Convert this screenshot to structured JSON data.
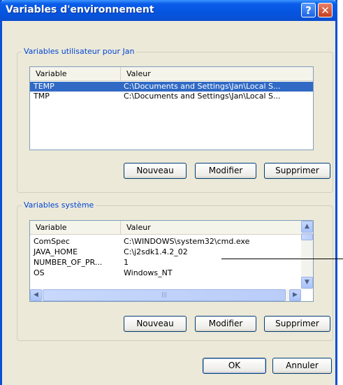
{
  "window": {
    "title": "Variables d'environnement",
    "help_glyph": "?",
    "close_glyph": "✕"
  },
  "user_vars": {
    "legend": "Variables utilisateur pour Jan",
    "columns": [
      "Variable",
      "Valeur"
    ],
    "rows": [
      {
        "name": "TEMP",
        "value": "C:\\Documents and Settings\\Jan\\Local S...",
        "selected": true
      },
      {
        "name": "TMP",
        "value": "C:\\Documents and Settings\\Jan\\Local S...",
        "selected": false
      }
    ],
    "buttons": {
      "new": "Nouveau",
      "edit": "Modifier",
      "delete": "Supprimer"
    }
  },
  "system_vars": {
    "legend": "Variables système",
    "columns": [
      "Variable",
      "Valeur"
    ],
    "rows": [
      {
        "name": "ComSpec",
        "value": "C:\\WINDOWS\\system32\\cmd.exe"
      },
      {
        "name": "JAVA_HOME",
        "value": "C:\\j2sdk1.4.2_02"
      },
      {
        "name": "NUMBER_OF_PR...",
        "value": "1"
      },
      {
        "name": "OS",
        "value": "Windows_NT"
      }
    ],
    "buttons": {
      "new": "Nouveau",
      "edit": "Modifier",
      "delete": "Supprimer"
    },
    "scroll_arrows": {
      "up": "▲",
      "down": "▼",
      "left": "◀",
      "right": "▶",
      "grip": "|||"
    }
  },
  "footer": {
    "ok": "OK",
    "cancel": "Annuler"
  },
  "colors": {
    "titlebar": "#0554e0",
    "legend": "#0046d5",
    "selection": "#316ac5",
    "dialog_bg": "#ece9d8"
  }
}
